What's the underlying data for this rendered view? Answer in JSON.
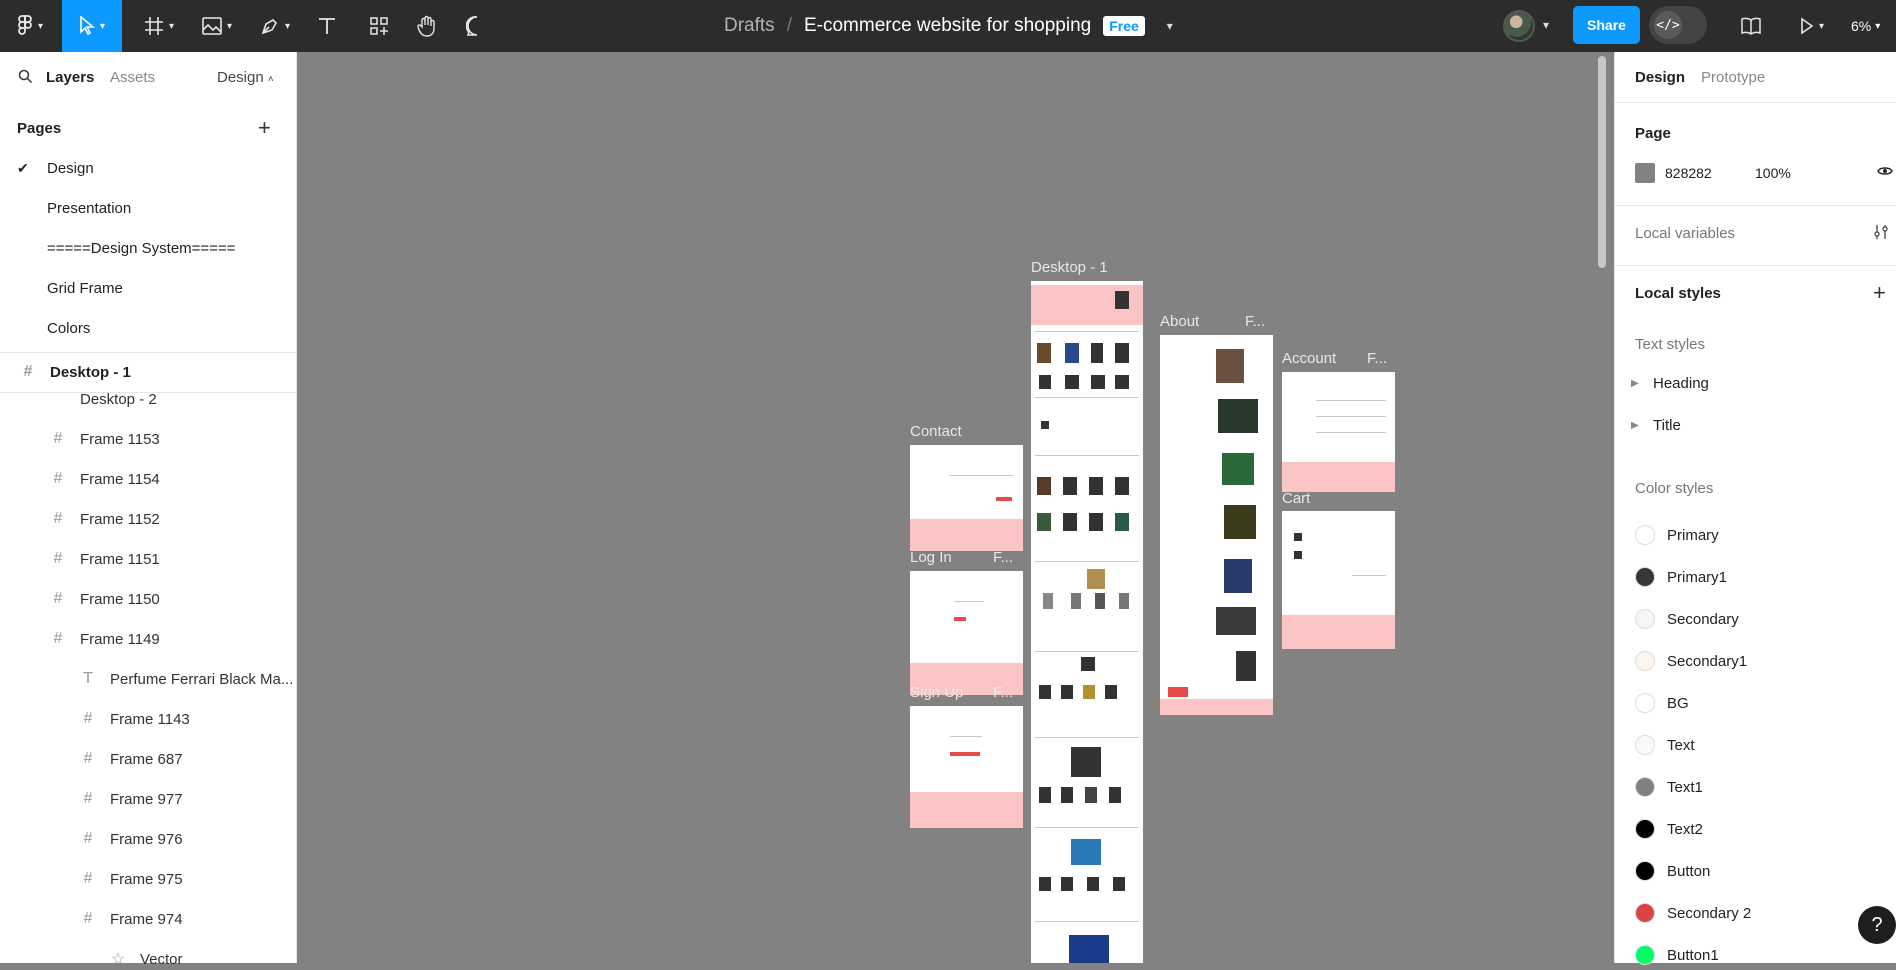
{
  "toolbar": {
    "breadcrumb_root": "Drafts",
    "file_name": "E-commerce website for shopping",
    "plan_badge": "Free",
    "share_label": "Share",
    "zoom_level": "6%"
  },
  "left_panel": {
    "tabs": {
      "layers": "Layers",
      "assets": "Assets",
      "mode": "Design"
    },
    "pages_heading": "Pages",
    "pages": [
      {
        "label": "Design",
        "selected": true
      },
      {
        "label": "Presentation"
      },
      {
        "label": "=====Design System====="
      },
      {
        "label": "Grid Frame"
      },
      {
        "label": "Colors"
      }
    ],
    "layers": [
      {
        "label": "Desktop - 1",
        "icon": "frame-icon",
        "indent": 0
      },
      {
        "label": "Desktop - 2",
        "icon": "frame-icon",
        "indent": 1
      },
      {
        "label": "Frame 1153",
        "icon": "frame-icon",
        "indent": 1
      },
      {
        "label": "Frame 1154",
        "icon": "frame-icon",
        "indent": 1
      },
      {
        "label": "Frame 1152",
        "icon": "frame-icon",
        "indent": 1
      },
      {
        "label": "Frame 1151",
        "icon": "frame-icon",
        "indent": 1
      },
      {
        "label": "Frame 1150",
        "icon": "frame-icon",
        "indent": 1
      },
      {
        "label": "Frame 1149",
        "icon": "frame-icon",
        "indent": 1
      },
      {
        "label": "Perfume Ferrari Black Ma...",
        "icon": "text-icon",
        "indent": 2
      },
      {
        "label": "Frame 1143",
        "icon": "frame-icon",
        "indent": 2
      },
      {
        "label": "Frame 687",
        "icon": "frame-icon",
        "indent": 2
      },
      {
        "label": "Frame 977",
        "icon": "frame-icon",
        "indent": 2
      },
      {
        "label": "Frame 976",
        "icon": "frame-icon",
        "indent": 2
      },
      {
        "label": "Frame 975",
        "icon": "frame-icon",
        "indent": 2
      },
      {
        "label": "Frame 974",
        "icon": "frame-icon",
        "indent": 2
      },
      {
        "label": "Vector",
        "icon": "star-icon",
        "indent": 3
      }
    ]
  },
  "canvas": {
    "frames": [
      {
        "label": "Desktop - 1"
      },
      {
        "label": "About"
      },
      {
        "label": "F..."
      },
      {
        "label": "Account"
      },
      {
        "label": "F..."
      },
      {
        "label": "Contact"
      },
      {
        "label": "Log In"
      },
      {
        "label": "F..."
      },
      {
        "label": "Sign Up"
      },
      {
        "label": "F..."
      },
      {
        "label": "Cart"
      }
    ]
  },
  "right_panel": {
    "tabs": {
      "design": "Design",
      "prototype": "Prototype"
    },
    "page_heading": "Page",
    "page_fill_hex": "828282",
    "page_fill_opacity": "100%",
    "local_variables": "Local variables",
    "local_styles": "Local styles",
    "text_styles_heading": "Text styles",
    "text_styles": [
      "Heading",
      "Title"
    ],
    "color_styles_heading": "Color styles",
    "color_styles": [
      {
        "name": "Primary",
        "color": "#ffffff"
      },
      {
        "name": "Primary1",
        "color": "#363738"
      },
      {
        "name": "Secondary",
        "color": "#f5f5f5"
      },
      {
        "name": "Secondary1",
        "color": "#fef6ea"
      },
      {
        "name": "BG",
        "color": "#ffffff"
      },
      {
        "name": "Text",
        "color": "#fafafa"
      },
      {
        "name": "Text1",
        "color": "#7d8184"
      },
      {
        "name": "Text2",
        "color": "#000000"
      },
      {
        "name": "Button",
        "color": "#000000"
      },
      {
        "name": "Secondary 2",
        "color": "#db4444"
      },
      {
        "name": "Button1",
        "color": "#00ff66"
      }
    ]
  },
  "help_label": "?"
}
